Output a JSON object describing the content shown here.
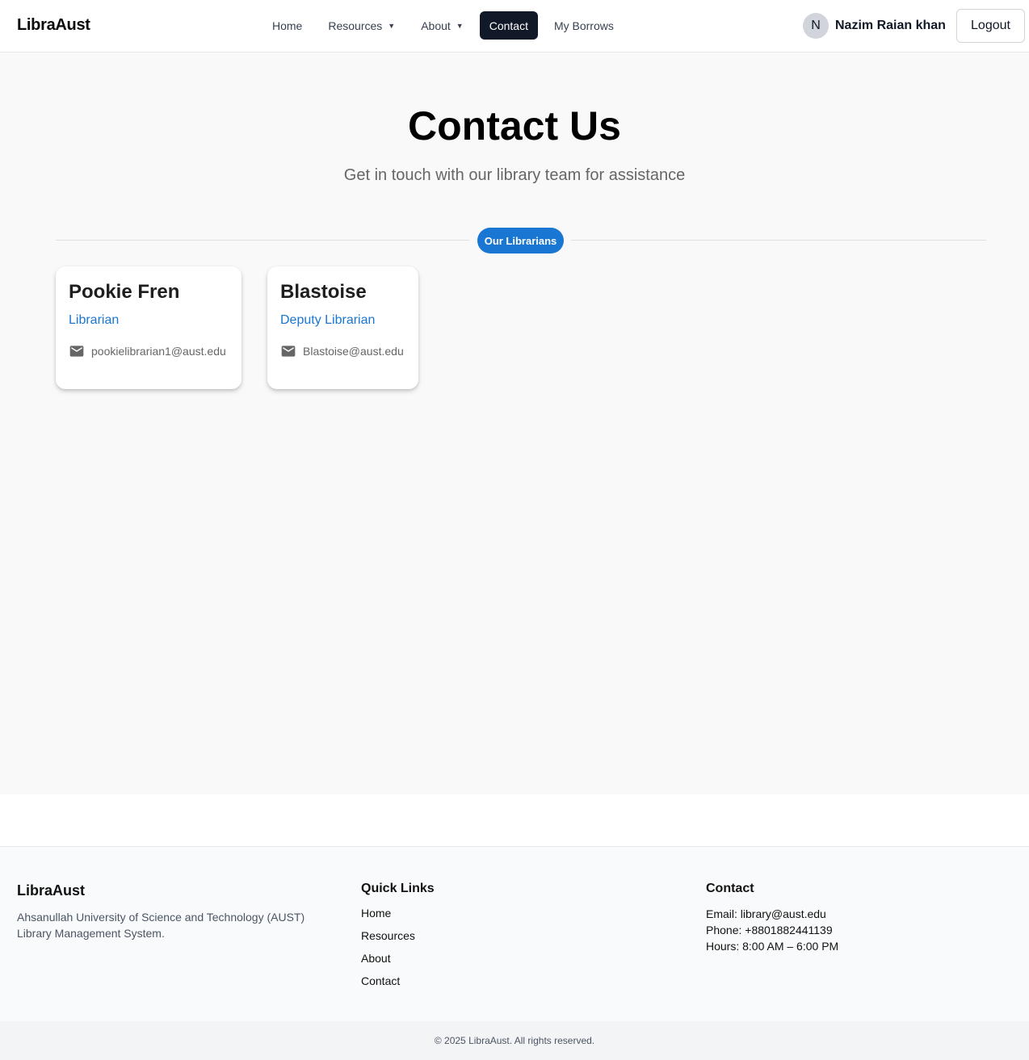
{
  "navbar": {
    "brand": "LibraAust",
    "links": [
      {
        "label": "Home"
      },
      {
        "label": "Resources"
      },
      {
        "label": "About"
      },
      {
        "label": "Contact"
      },
      {
        "label": "My Borrows"
      }
    ],
    "active_link": "Contact",
    "user": {
      "initial": "N",
      "name": "Nazim Raian khan"
    },
    "logout_label": "Logout"
  },
  "main": {
    "title": "Contact Us",
    "subtitle": "Get in touch with our library team for assistance",
    "section_chip": "Our Librarians",
    "librarians": [
      {
        "name": "Pookie Fren",
        "role": "Librarian",
        "email": "pookielibrarian1@aust.edu"
      },
      {
        "name": "Blastoise",
        "role": "Deputy Librarian",
        "email": "Blastoise@aust.edu"
      }
    ]
  },
  "footer": {
    "brand": "LibraAust",
    "description": "Ahsanullah University of Science and Technology (AUST) Library Management System.",
    "quick_links_heading": "Quick Links",
    "quick_links": [
      "Home",
      "Resources",
      "About",
      "Contact"
    ],
    "contact_heading": "Contact",
    "contact_lines": [
      "Email: library@aust.edu",
      "Phone: +8801882441139",
      "Hours: 8:00 AM – 6:00 PM"
    ],
    "copyright": "© 2025 LibraAust. All rights reserved."
  },
  "icons": {
    "dropdown": "caret-down-icon",
    "email": "mail-icon"
  },
  "colors": {
    "primary": "#1976d2",
    "nav_active_bg": "#111827",
    "page_bg": "#f9f9f9",
    "footer_bg": "#f9fafb"
  }
}
